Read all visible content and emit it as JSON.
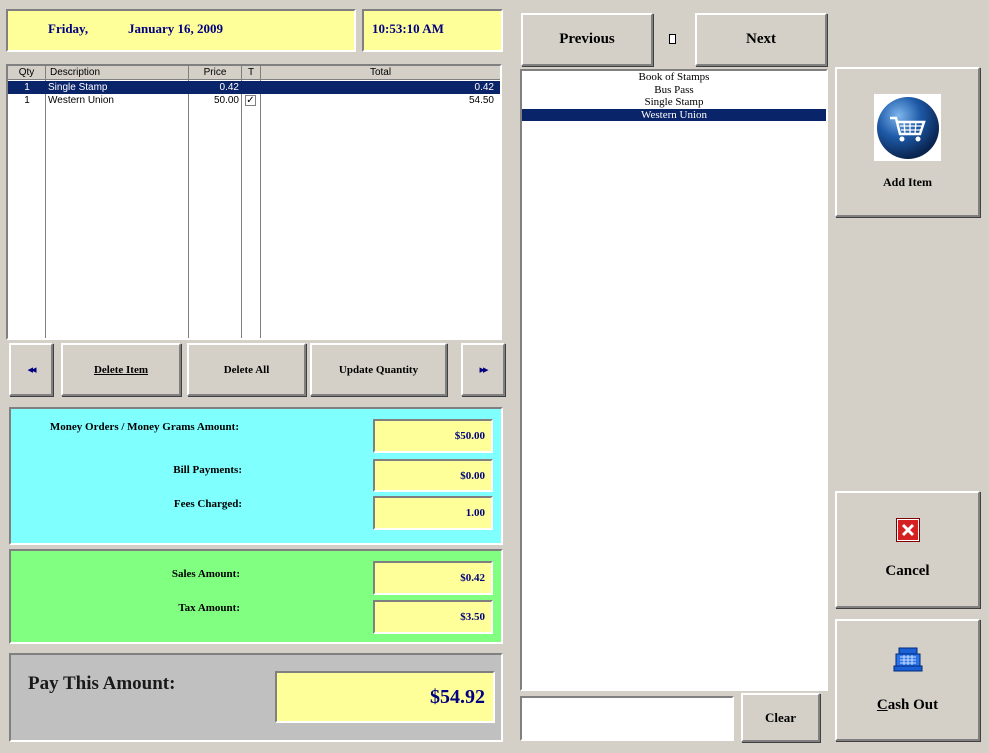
{
  "header": {
    "day": "Friday,",
    "date": "January 16, 2009",
    "time": "10:53:10 AM"
  },
  "grid": {
    "columns": [
      "Qty",
      "Description",
      "Price",
      "T",
      "Total"
    ],
    "rows": [
      {
        "qty": "1",
        "description": "Single Stamp",
        "price": "0.42",
        "taxed": false,
        "total": "0.42",
        "selected": true
      },
      {
        "qty": "1",
        "description": "Western Union",
        "price": "50.00",
        "taxed": true,
        "total": "54.50",
        "selected": false
      }
    ]
  },
  "actions": {
    "prev_glyph": "◂◂",
    "delete_item": "Delete Item",
    "delete_all": "Delete All",
    "update_quantity": "Update Quantity",
    "next_glyph": "▸▸"
  },
  "totals": {
    "money_orders_label": "Money Orders / Money Grams Amount:",
    "money_orders_value": "$50.00",
    "bill_payments_label": "Bill Payments:",
    "bill_payments_value": "$0.00",
    "fees_label": "Fees Charged:",
    "fees_value": "1.00",
    "sales_label": "Sales Amount:",
    "sales_value": "$0.42",
    "tax_label": "Tax Amount:",
    "tax_value": "$3.50",
    "pay_label": "Pay This Amount:",
    "pay_value": "$54.92"
  },
  "products": {
    "previous_label": "Previous",
    "next_label": "Next",
    "items": [
      "Book of Stamps",
      "Bus Pass",
      "Single Stamp",
      "Western Union"
    ],
    "selected_index": 3,
    "search_value": "",
    "clear_label": "Clear"
  },
  "side": {
    "add_item_label": "Add Item",
    "cancel_label": "Cancel",
    "cash_out_label": "Cash Out"
  },
  "colors": {
    "panel_yellow": "#ffff99",
    "panel_cyan": "#80ffff",
    "panel_green": "#80ff80",
    "selection": "#0a246a",
    "value_text": "#000080"
  }
}
